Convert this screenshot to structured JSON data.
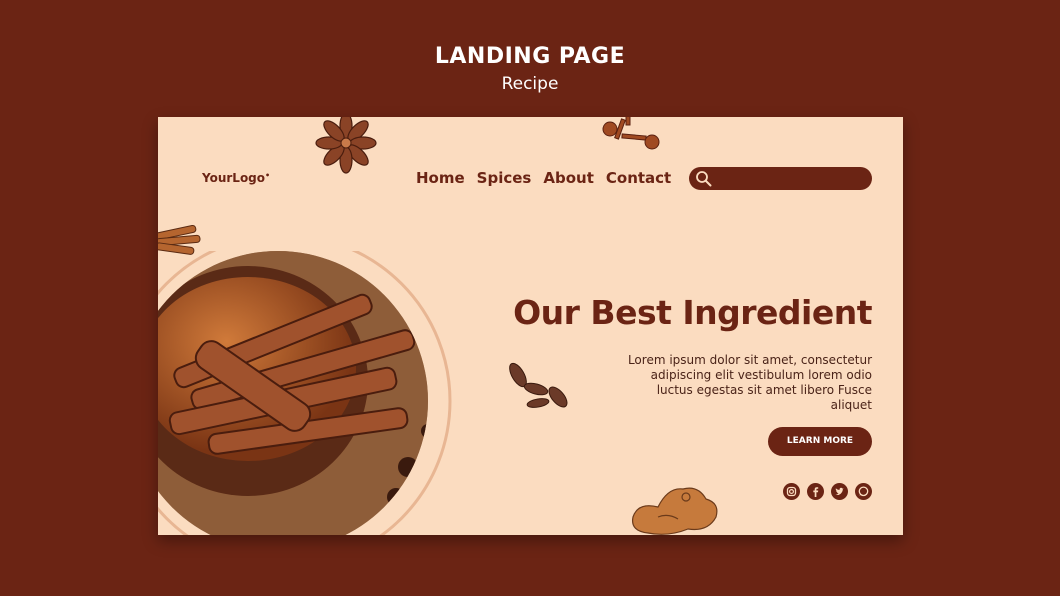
{
  "header": {
    "title": "LANDING PAGE",
    "subtitle": "Recipe"
  },
  "site": {
    "logo": "YourLogo",
    "nav": [
      {
        "label": "Home"
      },
      {
        "label": "Spices"
      },
      {
        "label": "About"
      },
      {
        "label": "Contact"
      }
    ],
    "search": {
      "placeholder": ""
    }
  },
  "hero": {
    "headline": "Our Best Ingredient",
    "description": "Lorem ipsum dolor sit amet, consectetur adipiscing elit vestibulum lorem odio luctus egestas sit amet libero Fusce aliquet",
    "button": "LEARN MORE"
  },
  "social": {
    "icons": [
      "instagram-icon",
      "facebook-icon",
      "twitter-icon",
      "whatsapp-icon"
    ]
  },
  "colors": {
    "background": "#6b2414",
    "card": "#fbdcc0",
    "accent": "#6b2414"
  }
}
